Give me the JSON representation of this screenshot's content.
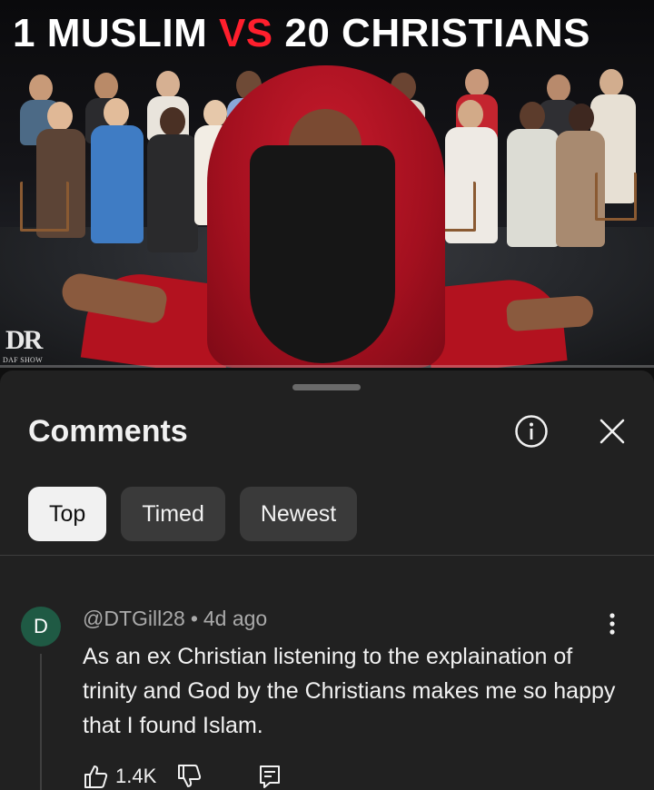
{
  "video": {
    "title_part1": "1 MUSLIM ",
    "title_vs": "VS",
    "title_part2": " 20 CHRISTIANS",
    "logo": "DR",
    "logo_sub": "DAF SHOW"
  },
  "comments_panel": {
    "title": "Comments",
    "chips": [
      "Top",
      "Timed",
      "Newest"
    ],
    "active_chip": "Top"
  },
  "comment": {
    "avatar_letter": "D",
    "author": "@DTGill28",
    "separator": "•",
    "time": "4d ago",
    "text": "As an ex Christian listening to the explaination of trinity and God by the Christians  makes me so happy that I found Islam.",
    "likes": "1.4K"
  },
  "colors": {
    "background": "#0f0f0f",
    "sheet": "#212121",
    "vs_red": "#ff1f2d",
    "avatar": "#1f5a44"
  },
  "icons": [
    "info-icon",
    "close-icon",
    "more-vert-icon",
    "thumb-up-icon",
    "thumb-down-icon",
    "reply-icon"
  ]
}
